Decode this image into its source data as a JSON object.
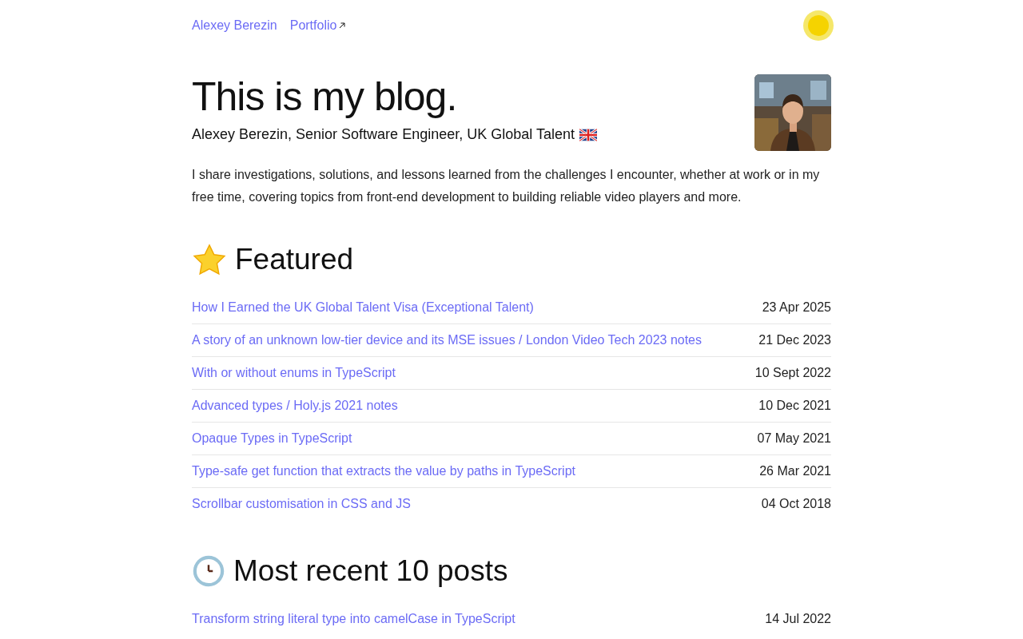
{
  "nav": {
    "links": [
      {
        "label": "Alexey Berezin",
        "external": false
      },
      {
        "label": "Portfolio",
        "external": true
      }
    ]
  },
  "hero": {
    "title": "This is my blog.",
    "subtitle": "Alexey Berezin, Senior Software Engineer, UK Global Talent",
    "flag": true
  },
  "intro": "I share investigations, solutions, and lessons learned from the challenges I encounter, whether at work or in my free time, covering topics from front-end development to building reliable video players and more.",
  "sections": [
    {
      "kind": "featured",
      "title": "Featured",
      "posts": [
        {
          "title": "How I Earned the UK Global Talent Visa (Exceptional Talent)",
          "date": "23 Apr 2025"
        },
        {
          "title": "A story of an unknown low-tier device and its MSE issues / London Video Tech 2023 notes",
          "date": "21 Dec 2023"
        },
        {
          "title": "With or without enums in TypeScript",
          "date": "10 Sept 2022"
        },
        {
          "title": "Advanced types / Holy.js 2021 notes",
          "date": "10 Dec 2021"
        },
        {
          "title": "Opaque Types in TypeScript",
          "date": "07 May 2021"
        },
        {
          "title": "Type-safe get function that extracts the value by paths in TypeScript",
          "date": "26 Mar 2021"
        },
        {
          "title": "Scrollbar customisation in CSS and JS",
          "date": "04 Oct 2018"
        }
      ]
    },
    {
      "kind": "recent",
      "title": "Most recent 10 posts",
      "posts": [
        {
          "title": "Transform string literal type into camelCase in TypeScript",
          "date": "14 Jul 2022"
        }
      ]
    }
  ]
}
